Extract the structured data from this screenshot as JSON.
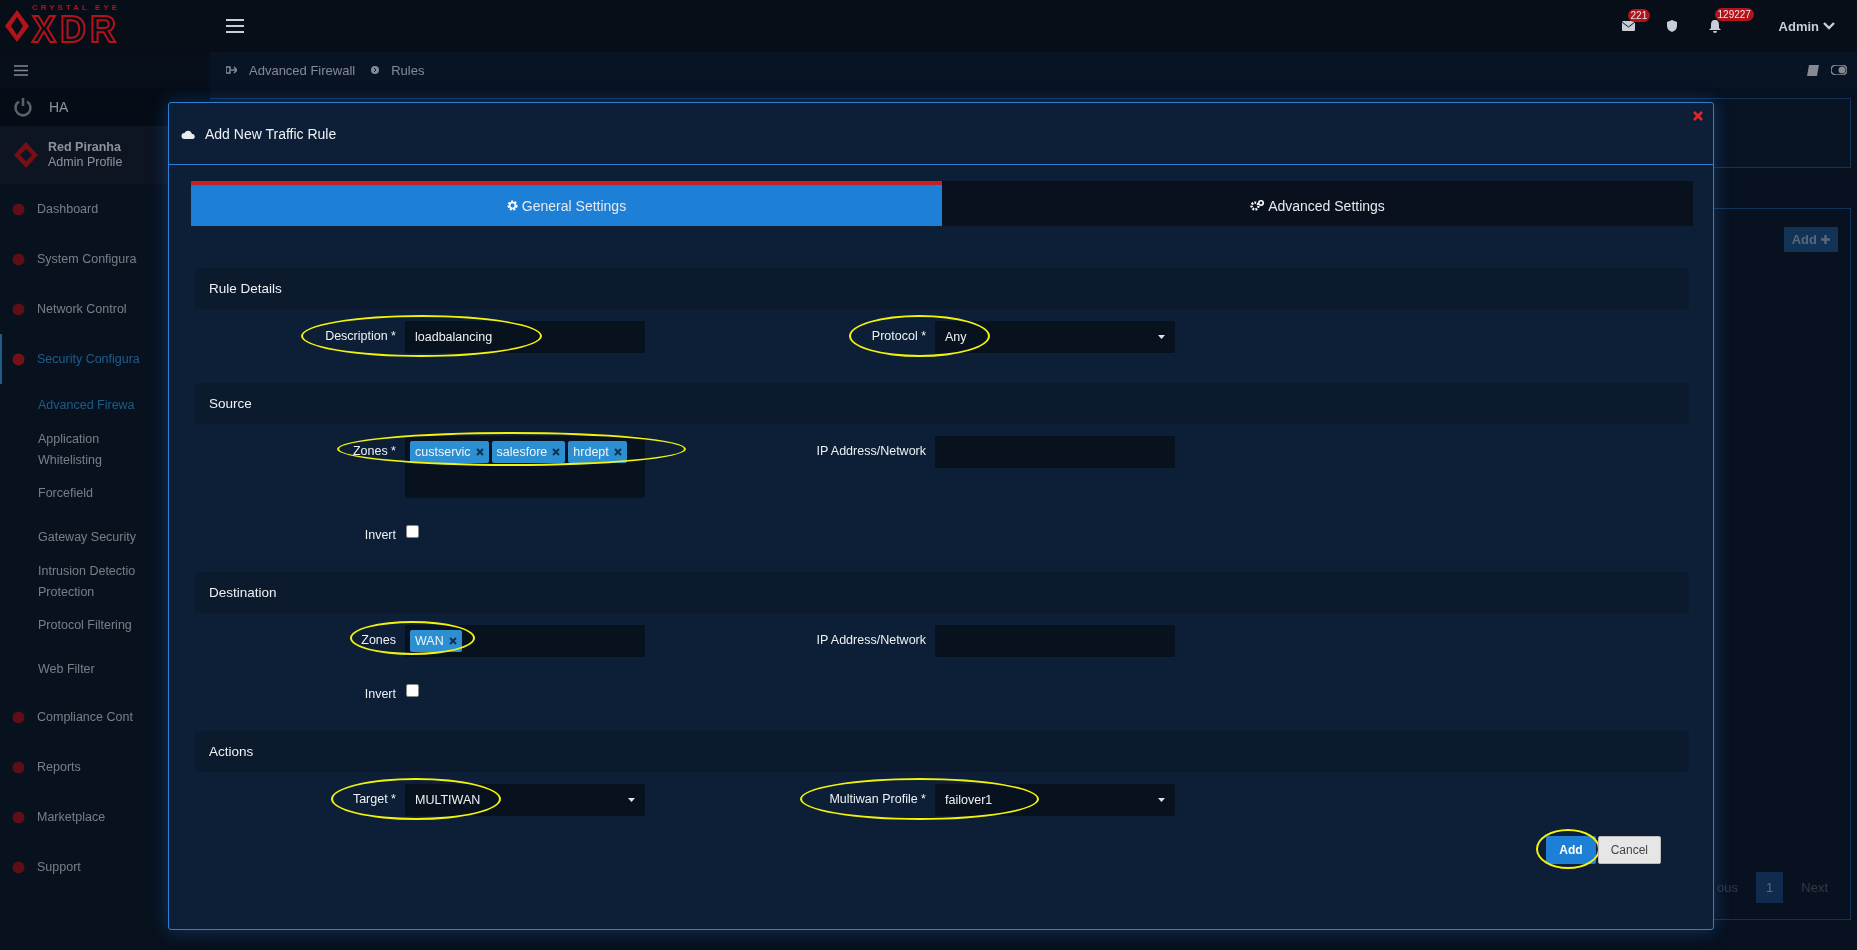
{
  "topbar": {
    "logo_small": "CRYSTAL EYE",
    "logo_big": "XDR",
    "mail_count": "221",
    "alert_count": "129227",
    "user": "Admin"
  },
  "breadcrumb": [
    "Advanced Firewall",
    "Rules"
  ],
  "sidebar": {
    "ha": "HA",
    "profile": {
      "name": "Red Piranha",
      "role": "Admin Profile"
    },
    "items": [
      {
        "label": "Dashboard",
        "selected": false
      },
      {
        "label": "System Configura",
        "selected": false
      },
      {
        "label": "Network Control",
        "selected": false
      },
      {
        "label": "Security Configura",
        "selected": true,
        "children": [
          {
            "label": "Advanced Firewa",
            "selected": true
          },
          {
            "label": "Application Whitelisting",
            "selected": false
          },
          {
            "label": "Forcefield",
            "selected": false
          },
          {
            "label": "Gateway Security",
            "selected": false
          },
          {
            "label": "Intrusion Detectio Protection",
            "selected": false
          },
          {
            "label": "Protocol Filtering",
            "selected": false
          },
          {
            "label": "Web Filter",
            "selected": false
          }
        ]
      },
      {
        "label": "Compliance Cont",
        "selected": false
      },
      {
        "label": "Reports",
        "selected": false
      },
      {
        "label": "Marketplace",
        "selected": false
      },
      {
        "label": "Support",
        "selected": false
      }
    ]
  },
  "background": {
    "add_button": "Add",
    "pagination": [
      {
        "label": "ous",
        "selected": false
      },
      {
        "label": "1",
        "selected": true
      },
      {
        "label": "Next",
        "selected": false
      }
    ]
  },
  "modal": {
    "title": "Add New Traffic Rule",
    "tabs": [
      {
        "label": "General Settings",
        "selected": true
      },
      {
        "label": "Advanced Settings",
        "selected": false
      }
    ],
    "sections": [
      {
        "title": "Rule Details",
        "rows": [
          [
            {
              "kind": "text",
              "label": "Description *",
              "value": "loadbalancing",
              "highlighted": true
            },
            {
              "kind": "select",
              "label": "Protocol *",
              "value": "Any",
              "highlighted": true
            }
          ]
        ]
      },
      {
        "title": "Source",
        "rows": [
          [
            {
              "kind": "tags",
              "label": "Zones *",
              "tags": [
                "custservic",
                "salesfore",
                "hrdept"
              ],
              "highlighted": true
            },
            {
              "kind": "text",
              "label": "IP Address/Network",
              "highlighted": false
            }
          ],
          [
            {
              "kind": "checkbox",
              "label": "Invert",
              "checked": false,
              "highlighted": false
            }
          ]
        ]
      },
      {
        "title": "Destination",
        "rows": [
          [
            {
              "kind": "tags",
              "label": "Zones",
              "tags": [
                "WAN"
              ],
              "highlighted": true
            },
            {
              "kind": "text",
              "label": "IP Address/Network",
              "highlighted": false
            }
          ],
          [
            {
              "kind": "checkbox",
              "label": "Invert",
              "checked": false,
              "highlighted": false
            }
          ]
        ]
      },
      {
        "title": "Actions",
        "rows": [
          [
            {
              "kind": "select",
              "label": "Target *",
              "value": "MULTIWAN",
              "highlighted": true
            },
            {
              "kind": "select",
              "label": "Multiwan Profile *",
              "value": "failover1",
              "highlighted": true
            }
          ]
        ]
      }
    ],
    "buttons": [
      {
        "kind": "primary",
        "label": "Add",
        "highlighted": true
      },
      {
        "kind": "secondary",
        "label": "Cancel",
        "highlighted": false
      }
    ]
  }
}
